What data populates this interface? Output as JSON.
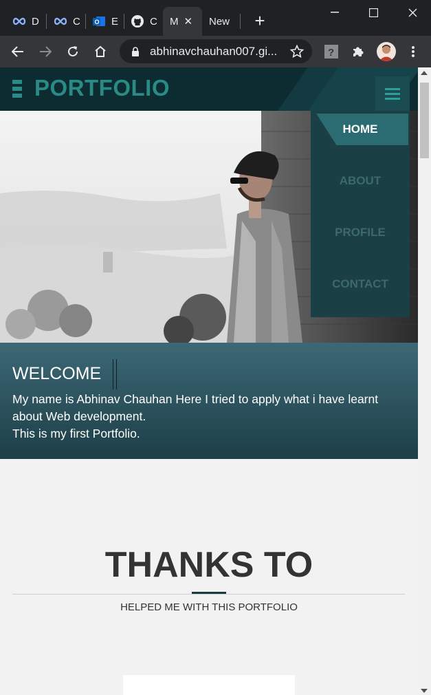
{
  "browser": {
    "tabs": [
      {
        "label": "D",
        "icon": "infinity-icon"
      },
      {
        "label": "C",
        "icon": "infinity-icon"
      },
      {
        "label": "E",
        "icon": "outlook-icon"
      },
      {
        "label": "C",
        "icon": "github-icon"
      },
      {
        "label": "M",
        "icon": "none",
        "active": true
      },
      {
        "label": "New",
        "icon": "none"
      }
    ],
    "url": "abhinavchauhan007.gi..."
  },
  "site": {
    "logo": "PORTFOLIO",
    "nav": [
      "HOME",
      "ABOUT",
      "PROFILE",
      "CONTACT"
    ],
    "welcome": {
      "title": "WELCOME",
      "line1": "My name is Abhinav Chauhan Here I tried to apply what i have learnt about Web development.",
      "line2": "This is my first Portfolio."
    },
    "thanks": {
      "title": "THANKS TO",
      "subtitle": "HELPED ME WITH THIS PORTFOLIO"
    }
  },
  "colors": {
    "header_bg": "#0d2c31",
    "accent": "#2a8a86",
    "nav_bg": "#1a3f44",
    "welcome_bg": "#2c5460"
  }
}
